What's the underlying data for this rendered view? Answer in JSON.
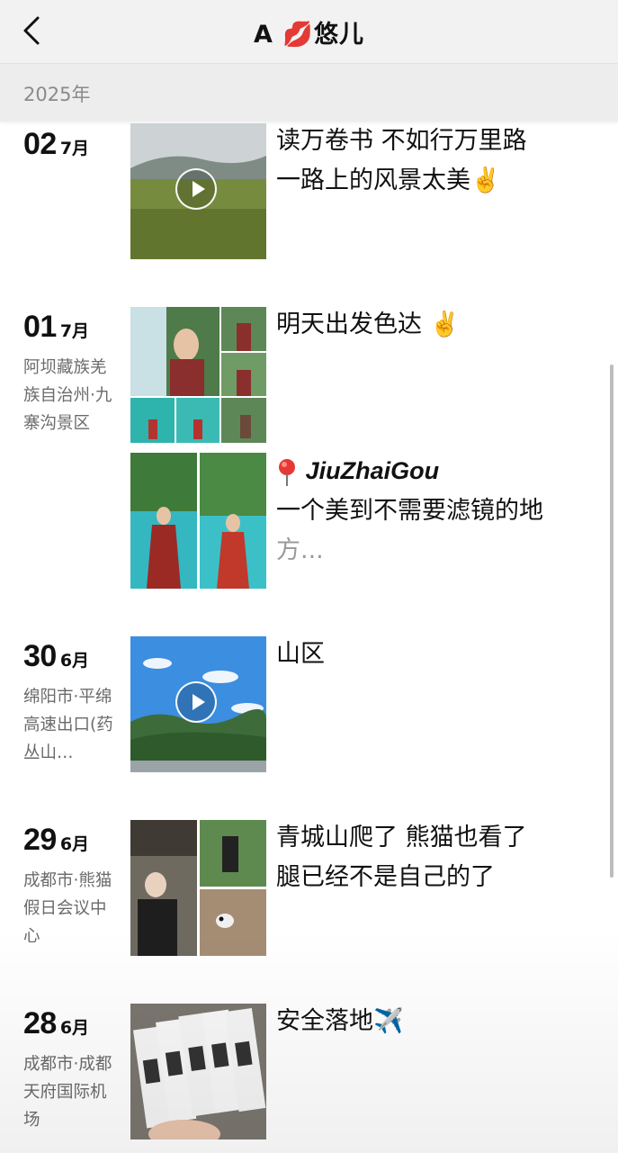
{
  "header": {
    "title": "A 💋悠儿"
  },
  "year_label": "2025年",
  "posts": [
    {
      "day": "02",
      "month": "7月",
      "location": "",
      "caption_lines": [
        "读万卷书 不如行万里路",
        "一路上的风景太美✌️"
      ]
    },
    {
      "day": "01",
      "month": "7月",
      "location": "阿坝藏族羌族自治州·九寨沟景区",
      "caption_lines": [
        "明天出发色达 ✌️"
      ]
    },
    {
      "pin_tag": "JiuZhaiGou",
      "caption_lines": [
        "一个美到不需要滤镜的地",
        "方..."
      ]
    },
    {
      "day": "30",
      "month": "6月",
      "location": "绵阳市·平绵高速出口(药丛山…",
      "caption_lines": [
        "山区"
      ]
    },
    {
      "day": "29",
      "month": "6月",
      "location": "成都市·熊猫假日会议中心",
      "caption_lines": [
        "青城山爬了 熊猫也看了",
        "腿已经不是自己的了"
      ]
    },
    {
      "day": "28",
      "month": "6月",
      "location": "成都市·成都天府国际机场",
      "caption_lines": [
        "安全落地✈️"
      ]
    }
  ],
  "icons": {
    "back": "chevron-left-icon",
    "play": "play-icon",
    "pin": "location-pin-icon"
  }
}
